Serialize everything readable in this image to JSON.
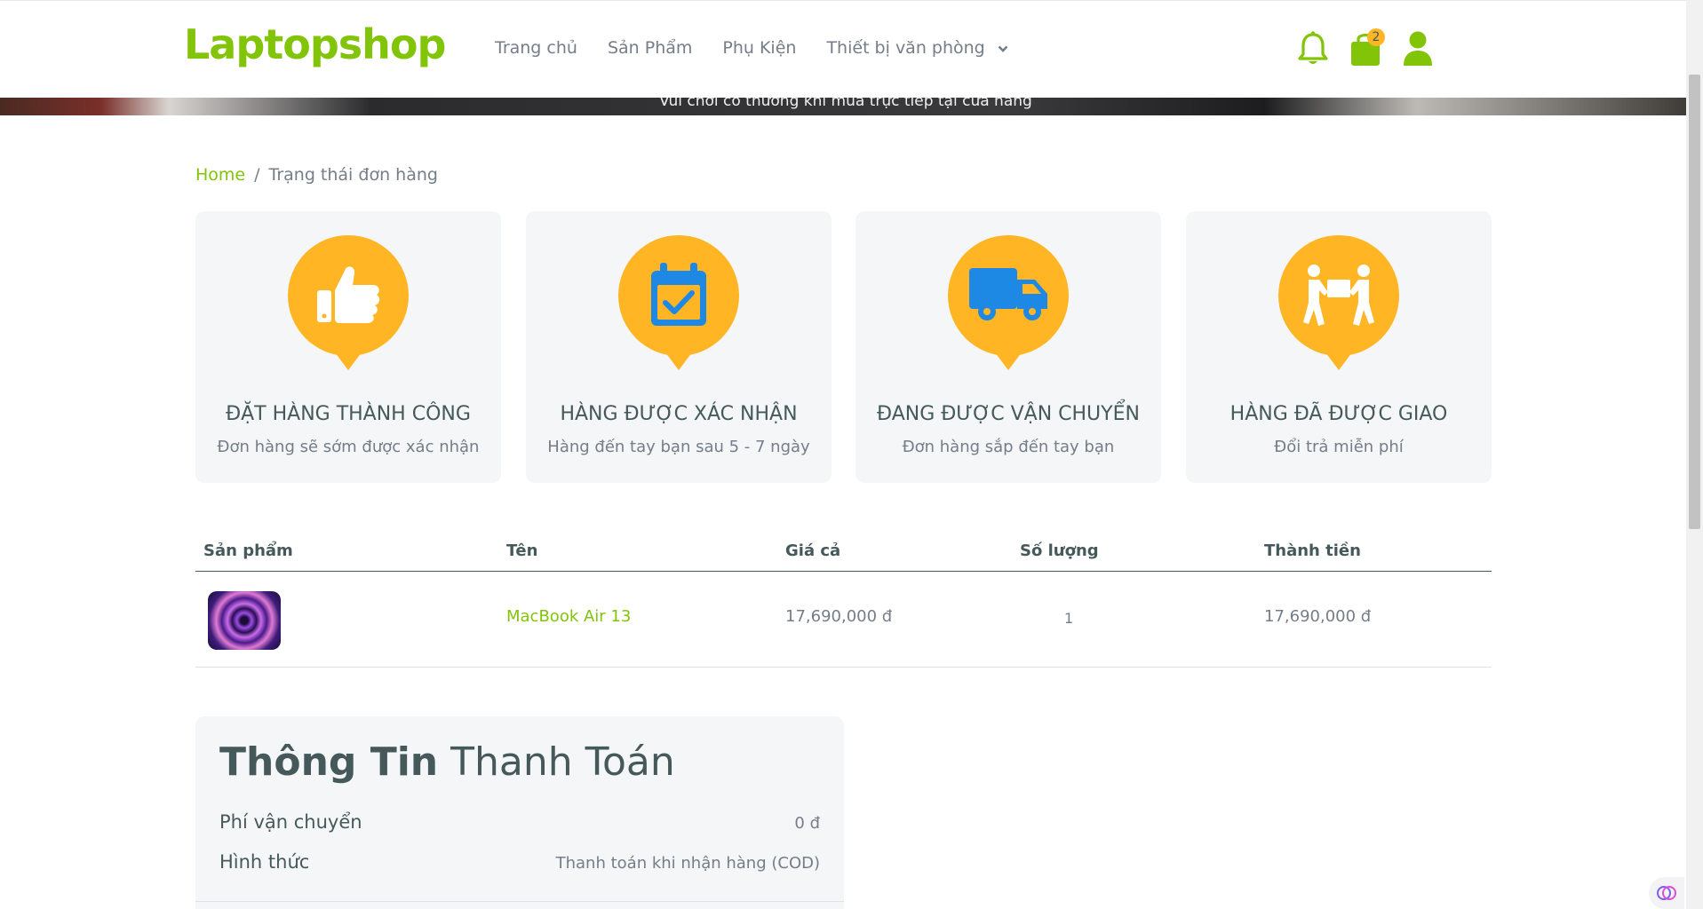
{
  "brand": {
    "logo": "Laptopshop",
    "accent": "#81c408",
    "secondary": "#ffb524",
    "icon_color": "#1e88e5"
  },
  "nav": {
    "items": [
      "Trang chủ",
      "Sản Phẩm",
      "Phụ Kiện"
    ],
    "dropdown_label": "Thiết bị văn phòng"
  },
  "header_icons": {
    "bell": "bell-icon",
    "cart": "shopping-bag-icon",
    "user": "user-icon",
    "cart_count": "2"
  },
  "banner": {
    "text": "Vui chơi có thưởng khi mua trực tiếp tại cửa hàng"
  },
  "breadcrumb": {
    "home": "Home",
    "separator": "/",
    "current": "Trạng thái đơn hàng"
  },
  "status_cards": [
    {
      "title": "ĐẶT HÀNG THÀNH CÔNG",
      "subtitle": "Đơn hàng sẽ sớm được xác nhận",
      "icon": "thumbs-up-icon"
    },
    {
      "title": "HÀNG ĐƯỢC XÁC NHẬN",
      "subtitle": "Hàng đến tay bạn sau 5 - 7 ngày",
      "icon": "calendar-check-icon"
    },
    {
      "title": "ĐANG ĐƯỢC VẬN CHUYỂN",
      "subtitle": "Đơn hàng sắp đến tay bạn",
      "icon": "truck-icon"
    },
    {
      "title": "HÀNG ĐÃ ĐƯỢC GIAO",
      "subtitle": "Đổi trả miễn phí",
      "icon": "people-carry-box-icon"
    }
  ],
  "table": {
    "headers": [
      "Sản phẩm",
      "Tên",
      "Giá cả",
      "Số lượng",
      "Thành tiền"
    ],
    "rows": [
      {
        "name": "MacBook Air 13",
        "price": "17,690,000 đ",
        "quantity": "1",
        "total": "17,690,000 đ"
      }
    ]
  },
  "payment": {
    "title_bold": "Thông Tin",
    "title_rest": "Thanh Toán",
    "shipping_label": "Phí vận chuyển",
    "shipping_value": "0 đ",
    "method_label": "Hình thức",
    "method_value": "Thanh toán khi nhận hàng (COD)"
  }
}
